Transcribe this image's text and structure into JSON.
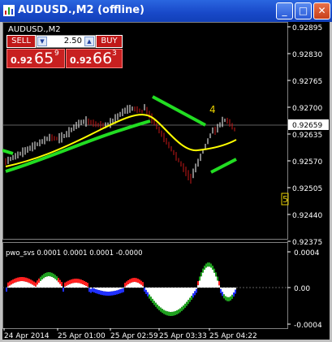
{
  "window": {
    "title": "AUDUSD.,M2 (offline)",
    "minimize_glyph": "_",
    "maximize_glyph": "□",
    "close_glyph": "✕"
  },
  "trade_panel": {
    "symbol_label": "AUDUSD.,M2",
    "sell_label": "SELL",
    "buy_label": "BUY",
    "lot_value": "2.50",
    "bid": {
      "main": "0.92",
      "big": "65",
      "sup": "9"
    },
    "ask": {
      "main": "0.92",
      "big": "66",
      "sup": "3"
    }
  },
  "main_chart": {
    "price_ticks": [
      "0.92895",
      "0.92830",
      "0.92765",
      "0.92700",
      "0.92635",
      "0.92570",
      "0.92505",
      "0.92440",
      "0.92375"
    ],
    "current_price": "0.92659",
    "marker_4": "4",
    "marker_5": "5",
    "colors": {
      "bull": "#ffffff",
      "bear": "#c81818",
      "ma": "#ffff00",
      "band": "#22dd22",
      "grid": "#808080"
    }
  },
  "indicator": {
    "label": "pwo_svs 0.0001 0.0001 0.0001 -0.0000",
    "ticks": [
      "0.0004",
      "0.00",
      "-0.0004"
    ],
    "colors": {
      "white": "#ffffff",
      "red": "#ff2020",
      "blue": "#2030ff",
      "green": "#20a020"
    }
  },
  "time_axis": [
    "24 Apr 2014",
    "25 Apr 01:00",
    "25 Apr 02:59",
    "25 Apr 03:33",
    "25 Apr 04:22"
  ]
}
